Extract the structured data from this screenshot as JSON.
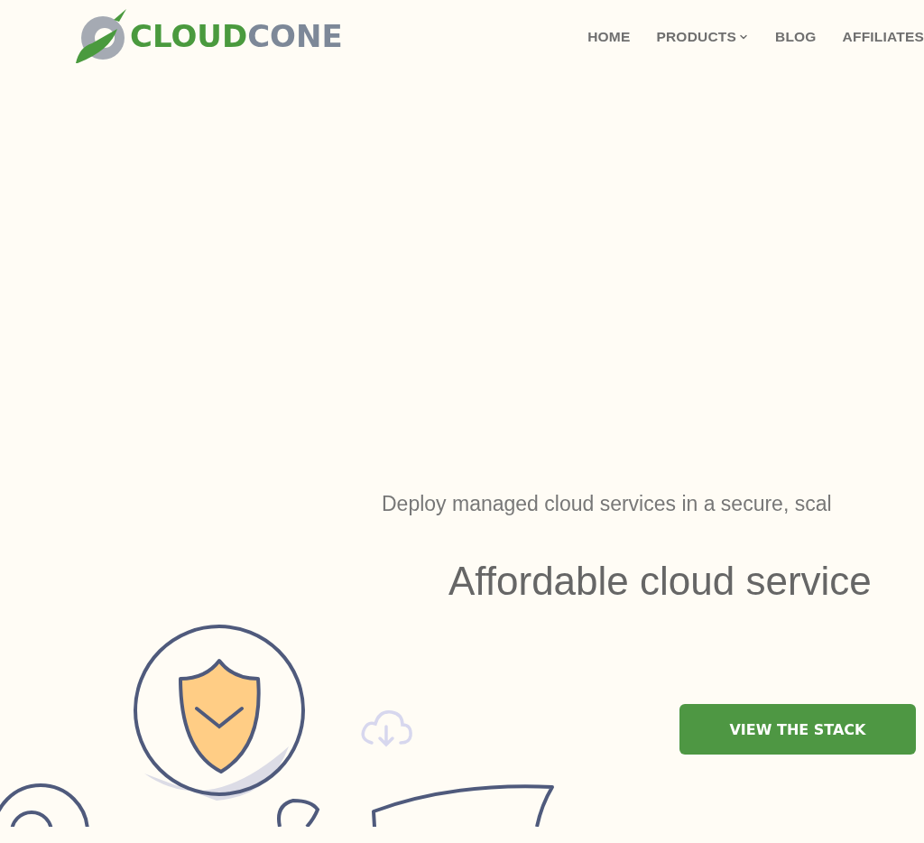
{
  "logo": {
    "parts": [
      "CLOUD",
      "CONE"
    ]
  },
  "nav": [
    {
      "label": "HOME",
      "dropdown": false
    },
    {
      "label": "PRODUCTS",
      "dropdown": true
    },
    {
      "label": "BLOG",
      "dropdown": false
    },
    {
      "label": "AFFILIATES",
      "dropdown": false
    }
  ],
  "hero": {
    "subtitle": "Deploy managed cloud services in a secure, scal",
    "heading": "Affordable cloud service",
    "button": "VIEW THE STACK"
  }
}
